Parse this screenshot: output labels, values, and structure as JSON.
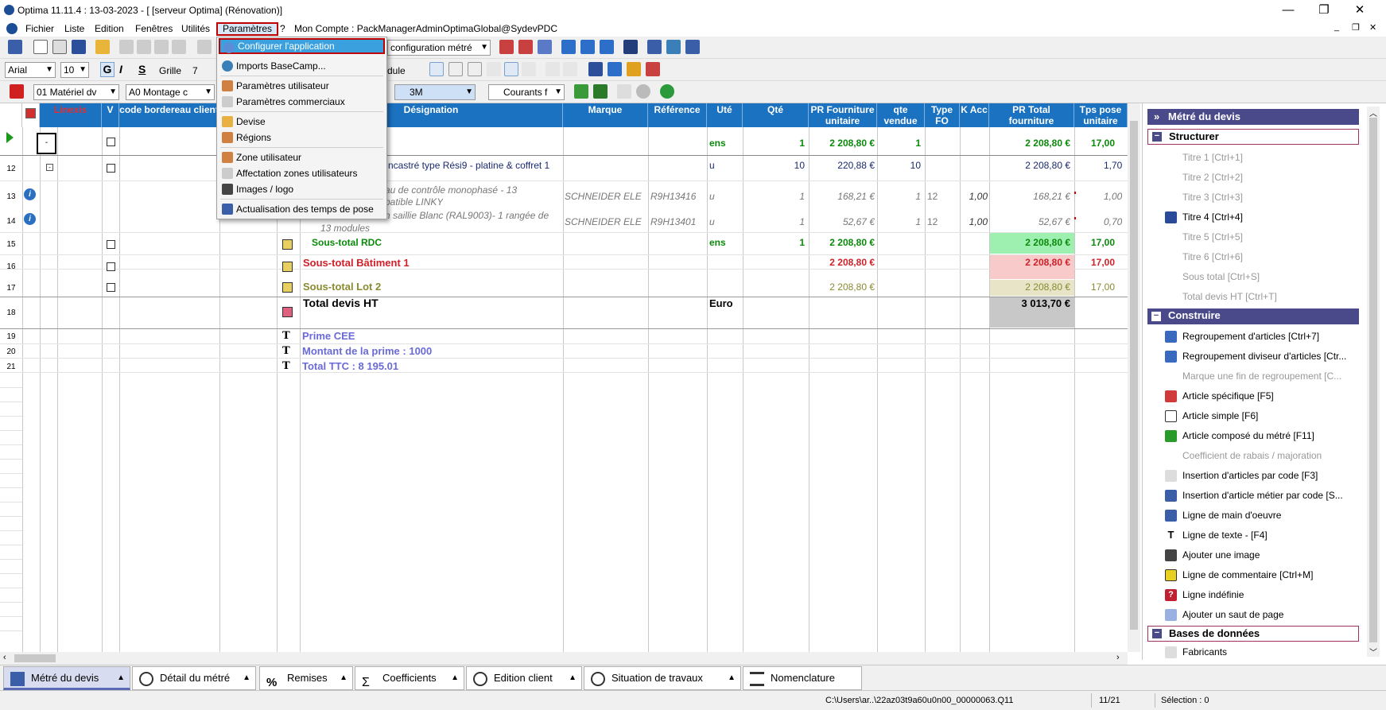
{
  "window": {
    "title": "Optima 11.11.4 : 13-03-2023 - [ [serveur Optima] (Rénovation)]",
    "min": "—",
    "max": "❐",
    "close": "✕"
  },
  "menubar": {
    "items": [
      "Fichier",
      "Liste",
      "Edition",
      "Fenêtres",
      "Utilités",
      "Paramètres",
      "?"
    ],
    "account": "Mon Compte : PackManagerAdminOptimaGlobal@SydevPDC",
    "mdi": [
      "_",
      "❐",
      "✕"
    ]
  },
  "toolbar": {
    "config_combo": "configuration métré",
    "font": "Arial",
    "font_size": "10",
    "bold": "G",
    "italic": "I",
    "underline": "S",
    "grid_label": "Grille",
    "grid_value": "7",
    "module_label": "dule",
    "cat_combo": "01  Matériel dv",
    "sub_combo": "A0  Montage c",
    "unit_combo": "3M",
    "courants_combo": "Courants f"
  },
  "dropdown": {
    "items": [
      {
        "label": "Configurer l'application",
        "icon": "settings-app-icon",
        "selected": true
      },
      {
        "label": "Imports BaseCamp...",
        "icon": "import-icon"
      },
      {
        "label": "Paramètres utilisateur",
        "icon": "users-icon"
      },
      {
        "label": "Paramètres commerciaux",
        "icon": "list-icon"
      },
      {
        "label": "Devise",
        "icon": "currency-icon"
      },
      {
        "label": "Régions",
        "icon": "regions-icon"
      },
      {
        "label": "Zone utilisateur",
        "icon": "users-zone-icon"
      },
      {
        "label": "Affectation zones utilisateurs",
        "icon": "list-icon"
      },
      {
        "label": "Images / logo",
        "icon": "camera-icon"
      },
      {
        "label": "Actualisation des temps de pose",
        "icon": "refresh-icon"
      }
    ]
  },
  "grid": {
    "headers": {
      "linexis": "Linexis",
      "v": "V",
      "code": "code bordereau client",
      "designation": "Désignation",
      "marque": "Marque",
      "reference": "Référence",
      "ute": "Uté",
      "qte": "Qté",
      "pr_fourniture": "PR Fourniture unitaire",
      "qte_vendue": "qte vendue",
      "type_fo": "Type FO",
      "k_acc": "K Acc",
      "pr_total": "PR Total fourniture",
      "tps_pose": "Tps pose unitaire"
    },
    "rows": {
      "r0": {
        "ute": "ens",
        "qte": "1",
        "pru": "2 208,80 €",
        "qv": "1",
        "prt": "2 208,80 €",
        "tps": "17,00"
      },
      "r12": {
        "num": "12",
        "designation": "ncastré type Rési9 - platine & coffret 1",
        "ute": "u",
        "qte": "10",
        "pru": "220,88 €",
        "qv": "10",
        "prt": "2 208,80 €",
        "tps": "1,70"
      },
      "r13": {
        "num": "13",
        "designation": "au de contrôle monophasé - 13",
        "designation2": "patible LINKY",
        "marque": "SCHNEIDER ELE",
        "ref": "R9H13416",
        "ute": "u",
        "qte": "1",
        "pru": "168,21 €",
        "qv": "1",
        "type": "12",
        "k": "1,00",
        "prt": "168,21 €",
        "tps": "1,00"
      },
      "r14": {
        "num": "14",
        "designation": "n saillie Blanc (RAL9003)- 1 rangée de",
        "designation2": "13 modules",
        "marque": "SCHNEIDER ELE",
        "ref": "R9H13401",
        "ute": "u",
        "qte": "1",
        "pru": "52,67 €",
        "qv": "1",
        "type": "12",
        "k": "1,00",
        "prt": "52,67 €",
        "tps": "0,70"
      },
      "r15": {
        "num": "15",
        "designation": "Sous-total RDC",
        "ute": "ens",
        "qte": "1",
        "pru": "2 208,80 €",
        "prt": "2 208,80 €",
        "tps": "17,00"
      },
      "r16": {
        "num": "16",
        "designation": "Sous-total Bâtiment 1",
        "pru": "2 208,80 €",
        "prt": "2 208,80 €",
        "tps": "17,00"
      },
      "r17": {
        "num": "17",
        "designation": "Sous-total Lot 2",
        "pru": "2 208,80 €",
        "prt": "2 208,80 €",
        "tps": "17,00"
      },
      "r18": {
        "num": "18",
        "designation": "Total devis HT",
        "ute": "Euro",
        "prt": "3 013,70 €"
      },
      "r19": {
        "num": "19",
        "designation": "Prime CEE"
      },
      "r20": {
        "num": "20",
        "designation": "Montant  de la prime : 1000"
      },
      "r21": {
        "num": "21",
        "designation": "Total TTC : 8 195.01"
      }
    }
  },
  "right_panel": {
    "title": "Métré du devis",
    "sections": {
      "structurer": "Structurer",
      "construire": "Construire",
      "bases": "Bases de données"
    },
    "structurer_items": [
      "Titre 1 [Ctrl+1]",
      "Titre 2 [Ctrl+2]",
      "Titre 3 [Ctrl+3]",
      "Titre 4 [Ctrl+4]",
      "Titre 5 [Ctrl+5]",
      "Titre 6 [Ctrl+6]",
      "Sous total [Ctrl+S]",
      "Total devis HT [Ctrl+T]"
    ],
    "construire_items": [
      "Regroupement d'articles  [Ctrl+7]",
      "Regroupement diviseur d'articles [Ctr...",
      "Marque une fin de regroupement  [C...",
      "Article spécifique [F5]",
      "Article simple [F6]",
      "Article composé du métré [F11]",
      "Coefficient de rabais / majoration",
      "Insertion d'articles par code [F3]",
      "Insertion d'article métier par code [S...",
      "Ligne de main d'oeuvre",
      "Ligne de texte - [F4]",
      "Ajouter une image",
      "Ligne de commentaire [Ctrl+M]",
      "Ligne indéfinie",
      "Ajouter un saut de page"
    ],
    "bases_items": [
      "Fabricants"
    ]
  },
  "tabs": [
    "Métré du devis",
    "Détail du métré",
    "Remises",
    "Coefficients",
    "Edition client",
    "Situation de travaux",
    "Nomenclature"
  ],
  "statusbar": {
    "path": "C:\\Users\\ar..\\22az03t9a60u0n00_00000063.Q11",
    "page": "11/21",
    "selection": "Sélection : 0"
  },
  "colors": {
    "header_blue": "#1a72c0",
    "green_text": "#0a8a0a",
    "red_text": "#d0202a",
    "olive_text": "#8a8a30",
    "purple_text": "#6a6ad8",
    "menu_highlight": "#c00000",
    "panel_purple": "#4a4a8a"
  }
}
